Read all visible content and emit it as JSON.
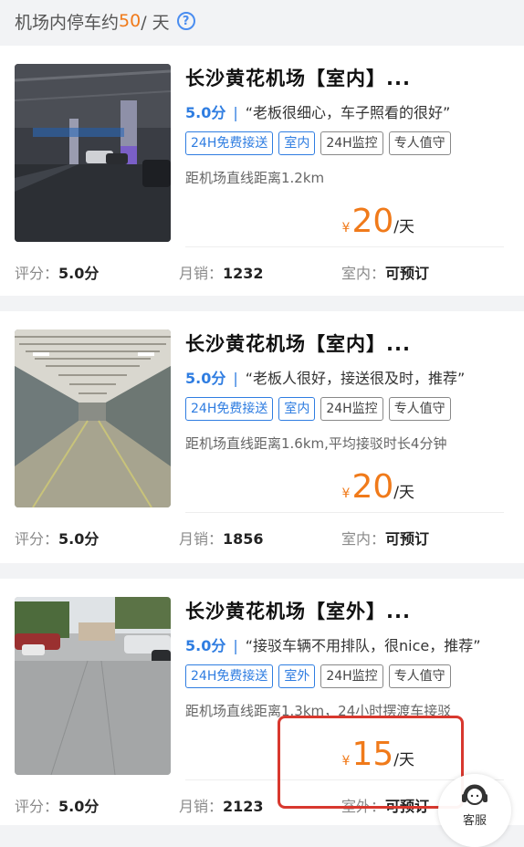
{
  "header": {
    "text_before": "机场内停车约",
    "count": "50",
    "text_after": " / 天",
    "help_glyph": "?"
  },
  "lots": [
    {
      "title": "长沙黄花机场【室内】...",
      "score": "5.0分",
      "separator": "|",
      "quote": "“老板很细心，车子照看的很好”",
      "tags": [
        "24H免费接送",
        "室内",
        "24H监控",
        "专人值守"
      ],
      "distance": "距机场直线距离1.2km",
      "currency": "¥",
      "price": "20",
      "unit": "/天",
      "rating_label": "评分：",
      "rating_value": "5.0分",
      "sales_label": "月销：",
      "sales_value": "1232",
      "type_label": "室内：",
      "type_value": "可预订"
    },
    {
      "title": "长沙黄花机场【室内】...",
      "score": "5.0分",
      "separator": "|",
      "quote": "“老板人很好，接送很及时，推荐”",
      "tags": [
        "24H免费接送",
        "室内",
        "24H监控",
        "专人值守"
      ],
      "distance": "距机场直线距离1.6km,平均接驳时长4分钟",
      "currency": "¥",
      "price": "20",
      "unit": "/天",
      "rating_label": "评分：",
      "rating_value": "5.0分",
      "sales_label": "月销：",
      "sales_value": "1856",
      "type_label": "室内：",
      "type_value": "可预订"
    },
    {
      "title": "长沙黄花机场【室外】...",
      "score": "5.0分",
      "separator": "|",
      "quote": "“接驳车辆不用排队，很nice，推荐”",
      "tags": [
        "24H免费接送",
        "室外",
        "24H监控",
        "专人值守"
      ],
      "distance": "距机场直线距离1.3km，24小时摆渡车接驳",
      "currency": "¥",
      "price": "15",
      "unit": "/天",
      "rating_label": "评分：",
      "rating_value": "5.0分",
      "sales_label": "月销：",
      "sales_value": "2123",
      "type_label": "室外：",
      "type_value": "可预订"
    }
  ],
  "service": {
    "label": "客服",
    "icon": "headset-icon"
  },
  "colors": {
    "accent_orange": "#f07a1a",
    "tag_blue": "#2f7de1",
    "highlight_red": "#d8382e"
  }
}
